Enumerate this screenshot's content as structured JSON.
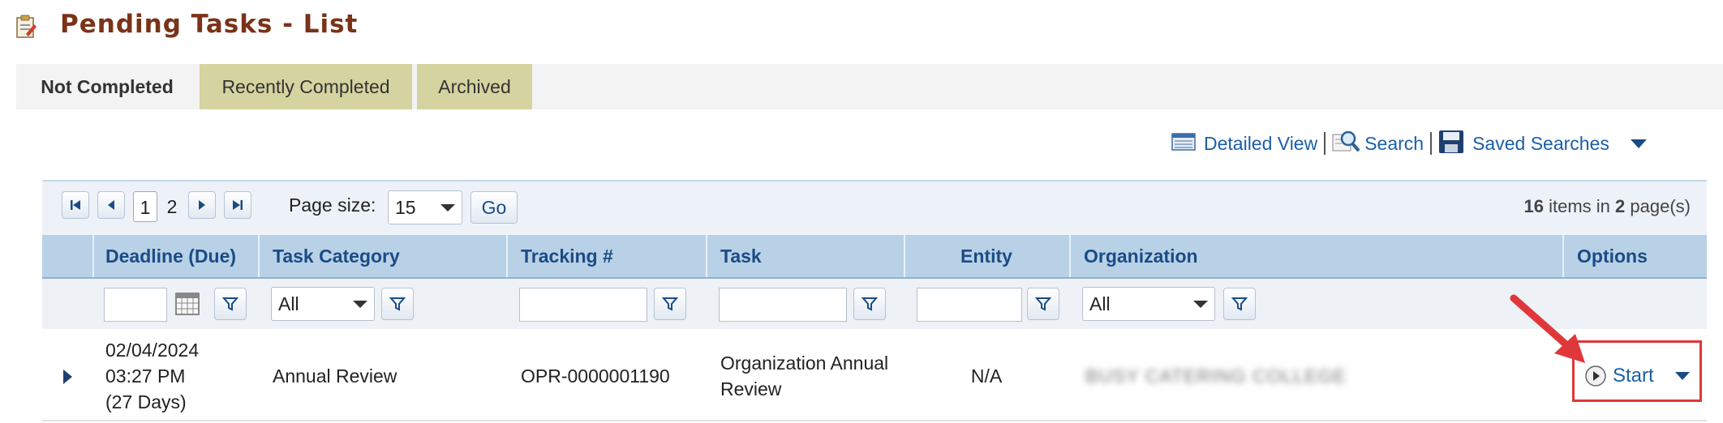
{
  "page": {
    "title": "Pending Tasks - List"
  },
  "tabs": [
    {
      "label": "Not Completed"
    },
    {
      "label": "Recently Completed"
    },
    {
      "label": "Archived"
    }
  ],
  "toolbar": {
    "detailed_view": "Detailed View",
    "search": "Search",
    "saved_searches": "Saved Searches"
  },
  "pager": {
    "page1": "1",
    "page2": "2",
    "page_size_label": "Page size:",
    "page_size_value": "15",
    "go_label": "Go",
    "items_count": "16",
    "items_text": "items in",
    "pages_count": "2",
    "pages_text": "page(s)"
  },
  "columns": {
    "deadline": "Deadline (Due)",
    "task_category": "Task Category",
    "tracking": "Tracking #",
    "task": "Task",
    "entity": "Entity",
    "organization": "Organization",
    "options": "Options"
  },
  "filters": {
    "task_category_value": "All",
    "organization_value": "All"
  },
  "rows": [
    {
      "deadline_date": "02/04/2024",
      "deadline_time": "03:27 PM",
      "deadline_days": "(27 Days)",
      "task_category": "Annual Review",
      "tracking": "OPR-0000001190",
      "task_line1": "Organization Annual",
      "task_line2": "Review",
      "entity": "N/A",
      "organization": "BUSY CATERING COLLEGE",
      "action": "Start"
    }
  ],
  "colors": {
    "title": "#7a3318",
    "link": "#1a5fa8",
    "header_bg": "#b9d1e6",
    "tab_inactive_bg": "#d5d3a0",
    "annotation": "#e0373a"
  }
}
